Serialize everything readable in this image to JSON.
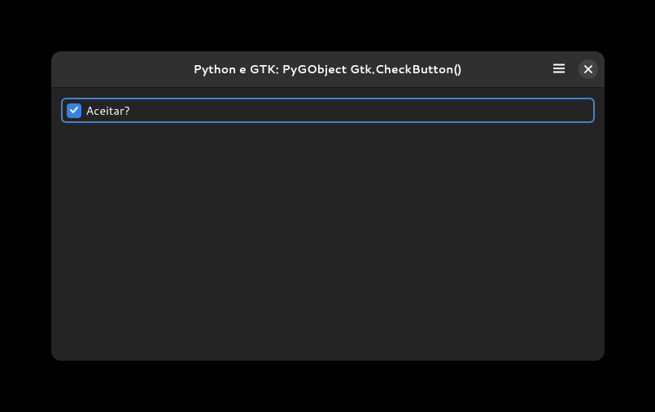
{
  "window": {
    "title": "Python e GTK: PyGObject Gtk.CheckButton()"
  },
  "content": {
    "checkbox": {
      "label": "Aceitar?",
      "checked": true
    }
  },
  "colors": {
    "accent": "#3584e4",
    "focus_ring": "#4a7fc4",
    "window_bg": "#242424",
    "header_bg": "#303030"
  }
}
